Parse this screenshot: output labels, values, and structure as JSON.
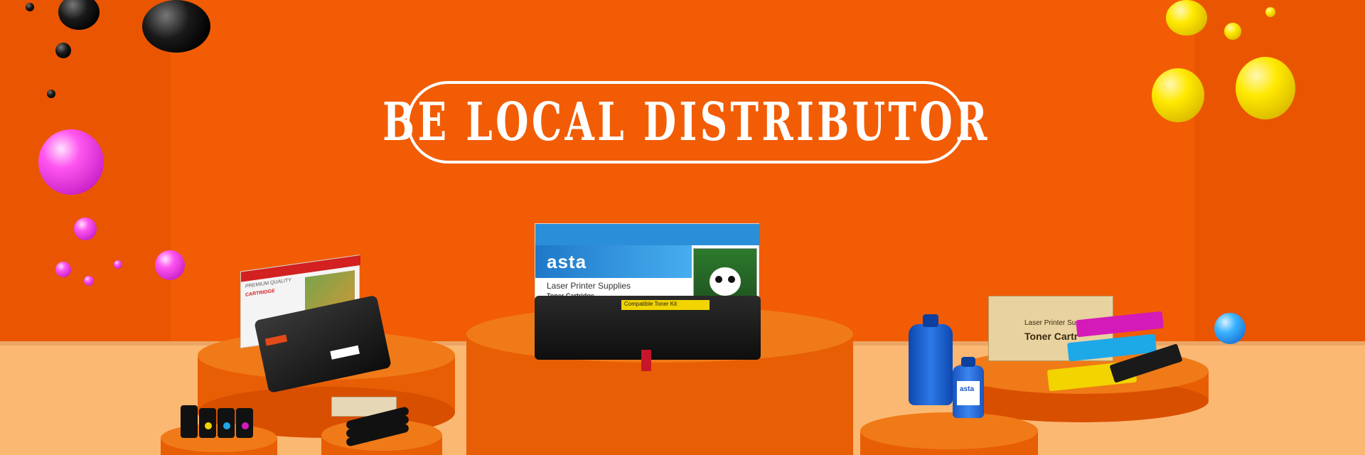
{
  "banner": {
    "title": "BE LOCAL DISTRIBUTOR"
  },
  "products": {
    "center_box": {
      "brand": "asta",
      "line1": "Laser Printer Supplies",
      "line2": "Toner Cartridge",
      "label": "Compatible Toner Kit"
    },
    "right_box": {
      "line1": "Laser Printer Supplies",
      "line2": "Toner Cartr"
    },
    "left_box": {
      "line1": "PREMIUM QUALITY",
      "line2": "CARTRIDGE"
    },
    "bottle_brand": "asta"
  },
  "colors": {
    "background": "#f25c05",
    "floor": "#fbb873",
    "podium": "#e85e05",
    "title": "#ffffff"
  }
}
